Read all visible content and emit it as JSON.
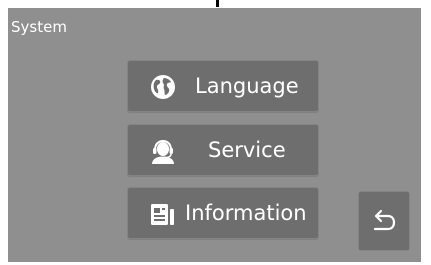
{
  "screen": {
    "title": "System"
  },
  "menu": {
    "items": [
      {
        "label": "Language",
        "icon": "globe-icon"
      },
      {
        "label": "Service",
        "icon": "headset-agent-icon"
      },
      {
        "label": "Information",
        "icon": "document-info-icon"
      }
    ]
  },
  "navigation": {
    "back_icon": "back-arrow-icon"
  },
  "colors": {
    "screen_background": "#8f8f8f",
    "button_background": "#6e6e6e",
    "text": "#ffffff"
  }
}
